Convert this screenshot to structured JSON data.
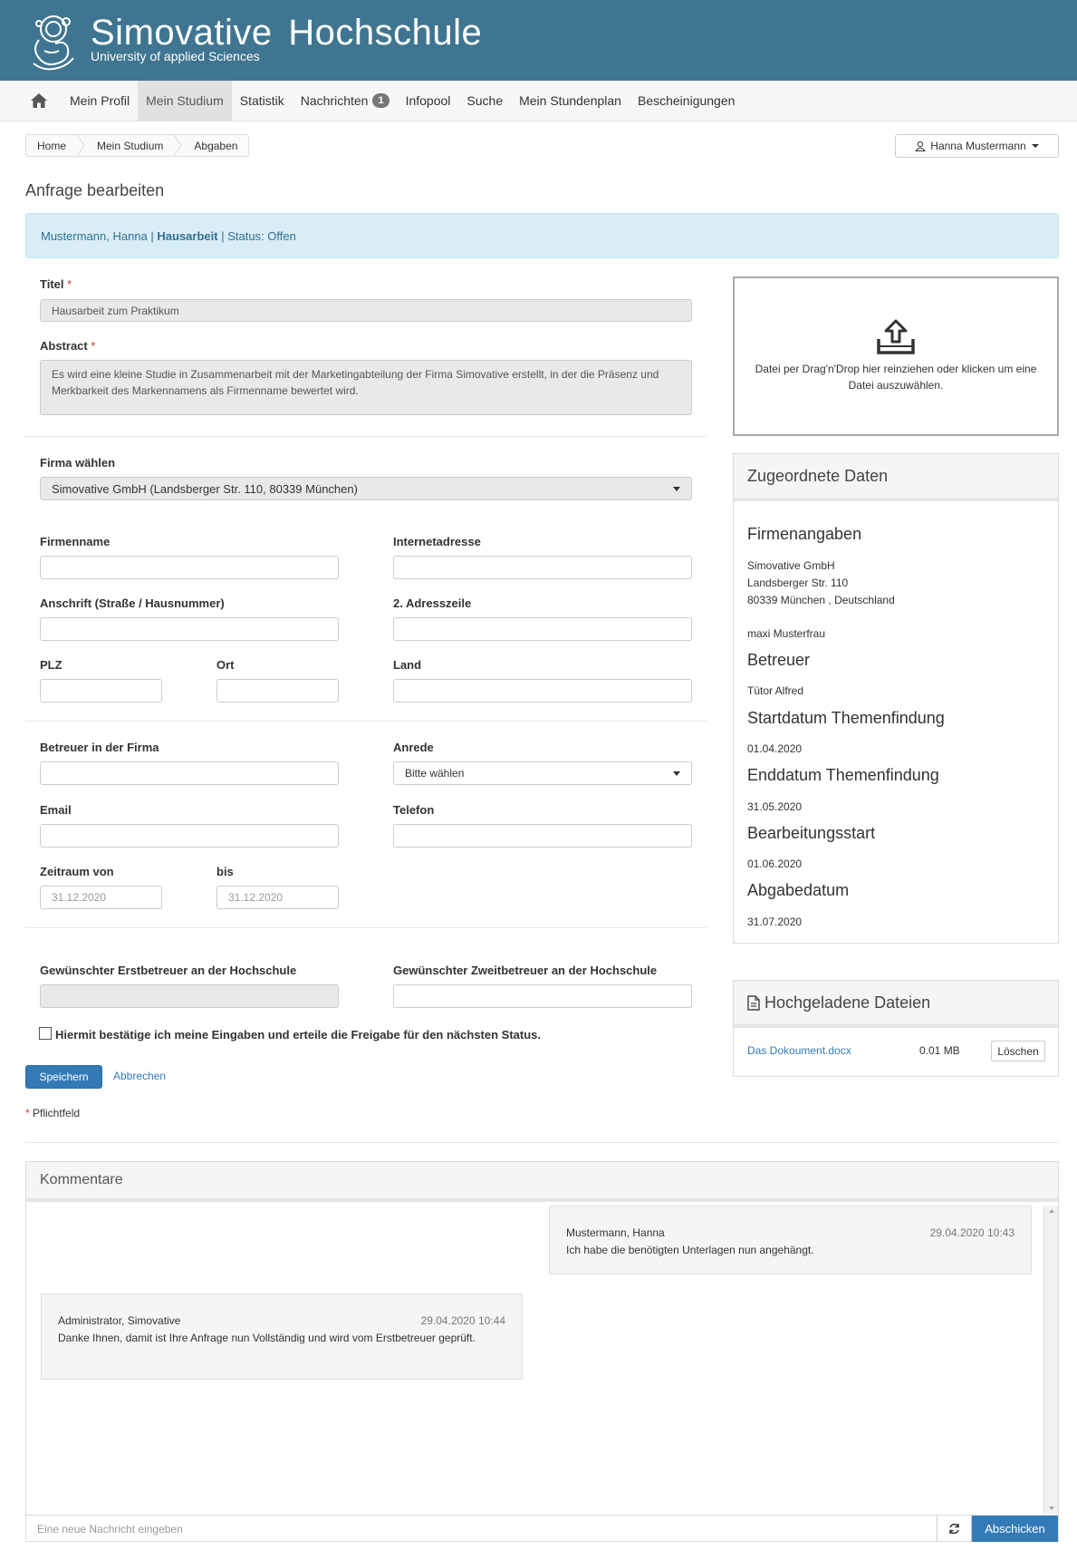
{
  "header": {
    "title": "Simovative  Hochschule",
    "subtitle": "University of applied Sciences"
  },
  "nav": {
    "items": [
      {
        "label": "Mein Profil"
      },
      {
        "label": "Mein Studium"
      },
      {
        "label": "Statistik"
      },
      {
        "label": "Nachrichten",
        "badge": "1"
      },
      {
        "label": "Infopool"
      },
      {
        "label": "Suche"
      },
      {
        "label": "Mein Stundenplan"
      },
      {
        "label": "Bescheinigungen"
      }
    ]
  },
  "breadcrumb": [
    "Home",
    "Mein Studium",
    "Abgaben"
  ],
  "user": {
    "name": "Hanna Mustermann"
  },
  "page": {
    "title": "Anfrage bearbeiten"
  },
  "info": {
    "name": "Mustermann, Hanna",
    "type": "Hausarbeit",
    "status": "Status: Offen"
  },
  "form": {
    "titel_label": "Titel",
    "titel_value": "Hausarbeit zum Praktikum",
    "abstract_label": "Abstract",
    "abstract_value": "Es wird eine kleine Studie in Zusammenarbeit mit der Marketingabteilung der Firma Simovative erstellt, in der die Präsenz und Merkbarkeit des Markennamens als Firmenname bewertet wird.",
    "firma_label": "Firma wählen",
    "firma_value": "Simovative GmbH (Landsberger Str. 110, 80339 München)",
    "firmenname_label": "Firmenname",
    "internet_label": "Internetadresse",
    "anschrift_label": "Anschrift (Straße / Hausnummer)",
    "adresszeile_label": "2. Adresszeile",
    "plz_label": "PLZ",
    "ort_label": "Ort",
    "land_label": "Land",
    "betreuer_label": "Betreuer in der Firma",
    "anrede_label": "Anrede",
    "anrede_value": "Bitte wählen",
    "email_label": "Email",
    "telefon_label": "Telefon",
    "von_label": "Zeitraum von",
    "von_value": "31.12.2020",
    "bis_label": "bis",
    "bis_value": "31.12.2020",
    "erst_label": "Gewünschter Erstbetreuer an der Hochschule",
    "zweit_label": "Gewünschter Zweitbetreuer an der Hochschule",
    "confirm_label": "Hiermit bestätige ich meine Eingaben und erteile die Freigabe für den nächsten Status.",
    "save": "Speichern",
    "cancel": "Abbrechen",
    "required_note": "Pflichtfeld",
    "required_mark": "*"
  },
  "dropzone": {
    "text": "Datei per Drag'n'Drop hier reinziehen oder klicken um eine Datei auszuwählen."
  },
  "zugeordnet": {
    "title": "Zugeordnete Daten",
    "firm_heading": "Firmenangaben",
    "firm_lines": [
      "Simovative GmbH",
      "Landsberger Str. 110",
      "80339 München , Deutschland"
    ],
    "contact": "maxi Musterfrau",
    "betreuer_heading": "Betreuer",
    "betreuer_value": "Tütor Alfred",
    "start_heading": "Startdatum Themenfindung",
    "start_value": "01.04.2020",
    "end_heading": "Enddatum Themenfindung",
    "end_value": "31.05.2020",
    "bearb_heading": "Bearbeitungsstart",
    "bearb_value": "01.06.2020",
    "abgabe_heading": "Abgabedatum",
    "abgabe_value": "31.07.2020"
  },
  "files": {
    "title": "Hochgeladene Dateien",
    "items": [
      {
        "name": "Das Dokoument.docx",
        "size": "0.01 MB",
        "action": "Löschen"
      }
    ]
  },
  "comments": {
    "title": "Kommentare",
    "messages": [
      {
        "author": "Mustermann, Hanna",
        "time": "29.04.2020 10:43",
        "text": "Ich habe die benötigten Unterlagen nun angehängt."
      },
      {
        "author": "Administrator, Simovative",
        "time": "29.04.2020 10:44",
        "text": "Danke Ihnen, damit ist Ihre Anfrage nun Vollständig und wird vom Erstbetreuer geprüft."
      }
    ],
    "placeholder": "Eine neue Nachricht eingeben",
    "send": "Abschicken"
  },
  "colors": {
    "header": "#3f7590",
    "primary": "#337ab7",
    "info_bg": "#d9edf7"
  }
}
